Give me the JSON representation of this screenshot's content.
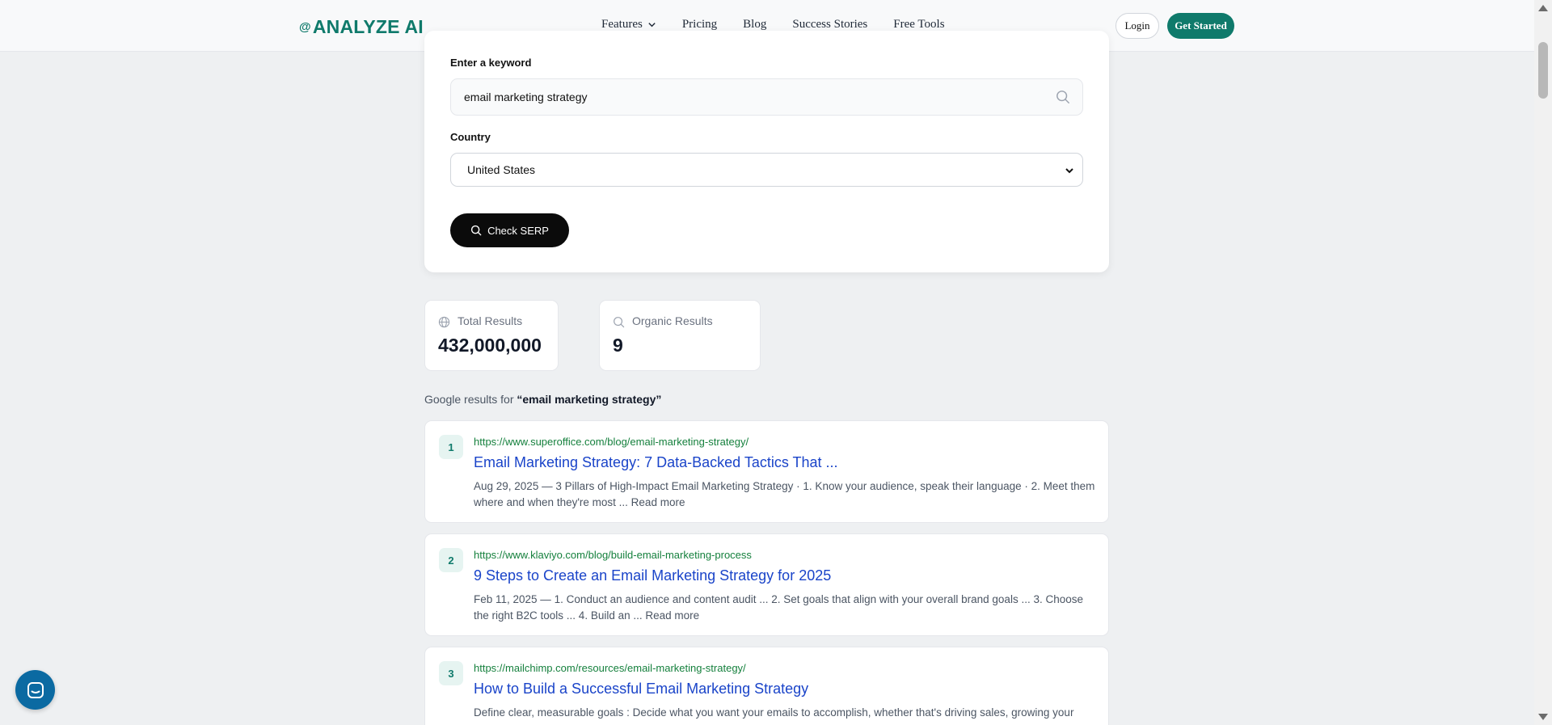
{
  "nav": {
    "logo": "ANALYZE AI",
    "logo_mark": "@",
    "links": [
      "Features",
      "Pricing",
      "Blog",
      "Success Stories",
      "Free Tools"
    ],
    "login": "Login",
    "get_started": "Get Started"
  },
  "search": {
    "keyword_label": "Enter a keyword",
    "keyword_value": "email marketing strategy",
    "country_label": "Country",
    "country_value": "United States",
    "button": "Check SERP"
  },
  "stats": {
    "total_label": "Total Results",
    "total_value": "432,000,000",
    "organic_label": "Organic Results",
    "organic_value": "9"
  },
  "results_heading": {
    "prefix": "Google results for",
    "query": "“email marketing strategy”"
  },
  "results": [
    {
      "rank": "1",
      "url": "https://www.superoffice.com/blog/email-marketing-strategy/",
      "title": "Email Marketing Strategy: 7 Data-Backed Tactics That ...",
      "snippet": "Aug 29, 2025 — 3 Pillars of High-Impact Email Marketing Strategy · 1. Know your audience, speak their language · 2. Meet them where and when they're most ... Read more"
    },
    {
      "rank": "2",
      "url": "https://www.klaviyo.com/blog/build-email-marketing-process",
      "title": "9 Steps to Create an Email Marketing Strategy for 2025",
      "snippet": "Feb 11, 2025 — 1. Conduct an audience and content audit ... 2. Set goals that align with your overall brand goals ... 3. Choose the right B2C tools ... 4. Build an ... Read more"
    },
    {
      "rank": "3",
      "url": "https://mailchimp.com/resources/email-marketing-strategy/",
      "title": "How to Build a Successful Email Marketing Strategy",
      "snippet": "Define clear, measurable goals : Decide what you want your emails to accomplish, whether that's driving sales, growing your"
    }
  ],
  "colors": {
    "brand": "#0f7a6b",
    "link": "#1a44c9",
    "url": "#15803d",
    "chat": "#0b6aa2"
  }
}
